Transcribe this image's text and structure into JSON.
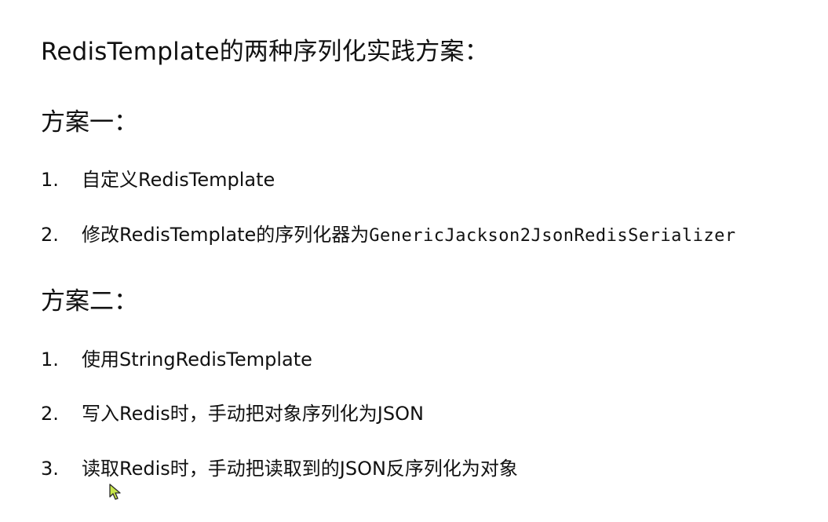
{
  "title": "RedisTemplate的两种序列化实践方案：",
  "plans": [
    {
      "heading": "方案一：",
      "items": [
        {
          "num": "1.",
          "text": "自定义RedisTemplate",
          "code": ""
        },
        {
          "num": "2.",
          "text": "修改RedisTemplate的序列化器为",
          "code": "GenericJackson2JsonRedisSerializer"
        }
      ]
    },
    {
      "heading": "方案二：",
      "items": [
        {
          "num": "1.",
          "text": "使用StringRedisTemplate",
          "code": ""
        },
        {
          "num": "2.",
          "text": "写入Redis时，手动把对象序列化为JSON",
          "code": ""
        },
        {
          "num": "3.",
          "text": "读取Redis时，手动把读取到的JSON反序列化为对象",
          "code": ""
        }
      ]
    }
  ],
  "cursor_icon": "mouse-pointer-icon",
  "colors": {
    "text": "#111111",
    "cursor_fill": "#c8e64a",
    "cursor_stroke": "#2a2a2a"
  }
}
